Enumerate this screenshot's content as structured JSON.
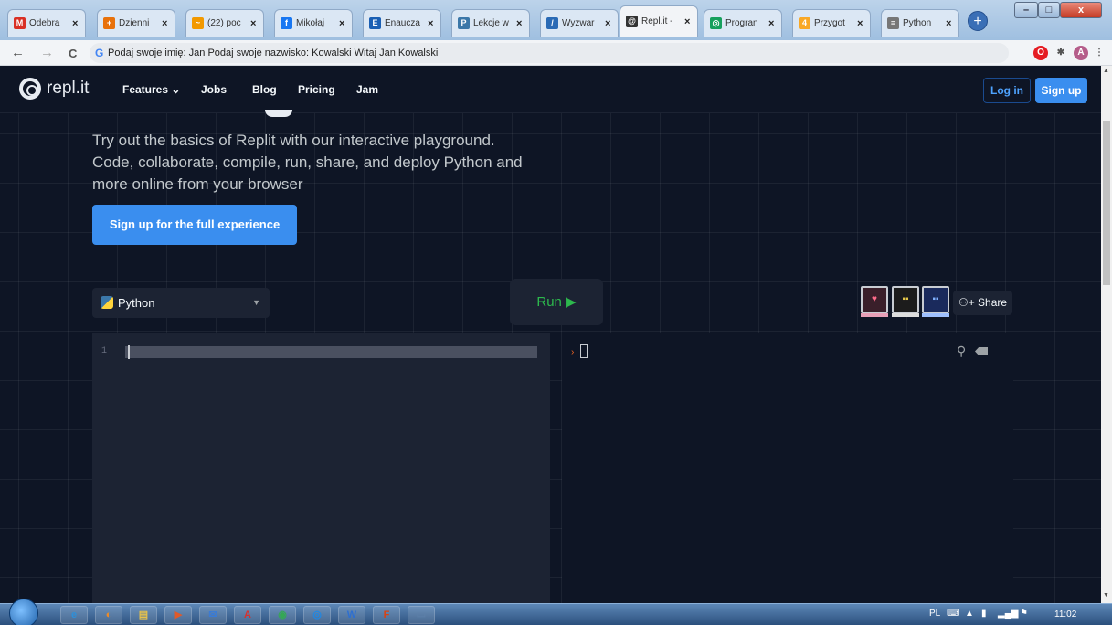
{
  "browser": {
    "tabs": [
      {
        "label": "Odebra",
        "fav": "M",
        "color": "#d93025",
        "active": false
      },
      {
        "label": "Dzienni",
        "fav": "+",
        "color": "#e8710a",
        "active": false
      },
      {
        "label": "(22) poc",
        "fav": "~",
        "color": "#f29900",
        "active": false
      },
      {
        "label": "Mikołaj",
        "fav": "f",
        "color": "#1877f2",
        "active": false
      },
      {
        "label": "Enaucza",
        "fav": "E",
        "color": "#1a5fb4",
        "active": false
      },
      {
        "label": "Lekcje w",
        "fav": "P",
        "color": "#3b77a8",
        "active": false
      },
      {
        "label": "Wyzwar",
        "fav": "/",
        "color": "#2a6ab5",
        "active": false
      },
      {
        "label": "Repl.it -",
        "fav": "@",
        "color": "#333333",
        "active": true
      },
      {
        "label": "Progran",
        "fav": "◎",
        "color": "#17a05d",
        "active": false
      },
      {
        "label": "Przygot",
        "fav": "4",
        "color": "#f9a825",
        "active": false
      },
      {
        "label": "Python",
        "fav": "≡",
        "color": "#777777",
        "active": false
      }
    ],
    "new_tab": "+",
    "window_buttons": {
      "minimize": "–",
      "maximize": "□",
      "close": "x"
    },
    "nav": {
      "back": "←",
      "forward": "→",
      "reload": "C"
    },
    "address": "Podaj swoje imię: Jan Podaj swoje nazwisko: Kowalski Witaj Jan Kowalski",
    "address_icon": "G",
    "extensions": {
      "opera": "O",
      "puzzle": "✱",
      "profile": "A",
      "menu": "⋮"
    }
  },
  "replit": {
    "logo_text": "repl.it",
    "nav": {
      "features": "Features ⌄",
      "jobs": "Jobs",
      "blog": "Blog",
      "pricing": "Pricing",
      "jam": "Jam"
    },
    "login": "Log in",
    "signup": "Sign up",
    "hero": "Try out the basics of Replit with our interactive playground. Code, collaborate, compile, run, share, and deploy Python and more online from your browser",
    "cta": "Sign up for the full experience",
    "language": "Python",
    "run": "Run ▶",
    "share": "⚇+ Share",
    "editor_line": "1",
    "console_prompt": "›"
  },
  "taskbar": {
    "items": [
      "e",
      "◐",
      "▤",
      "▶",
      "✉",
      "A",
      "◉",
      "◎",
      "W",
      "F",
      "▭"
    ],
    "lang": "PL",
    "clock": "11:02"
  }
}
